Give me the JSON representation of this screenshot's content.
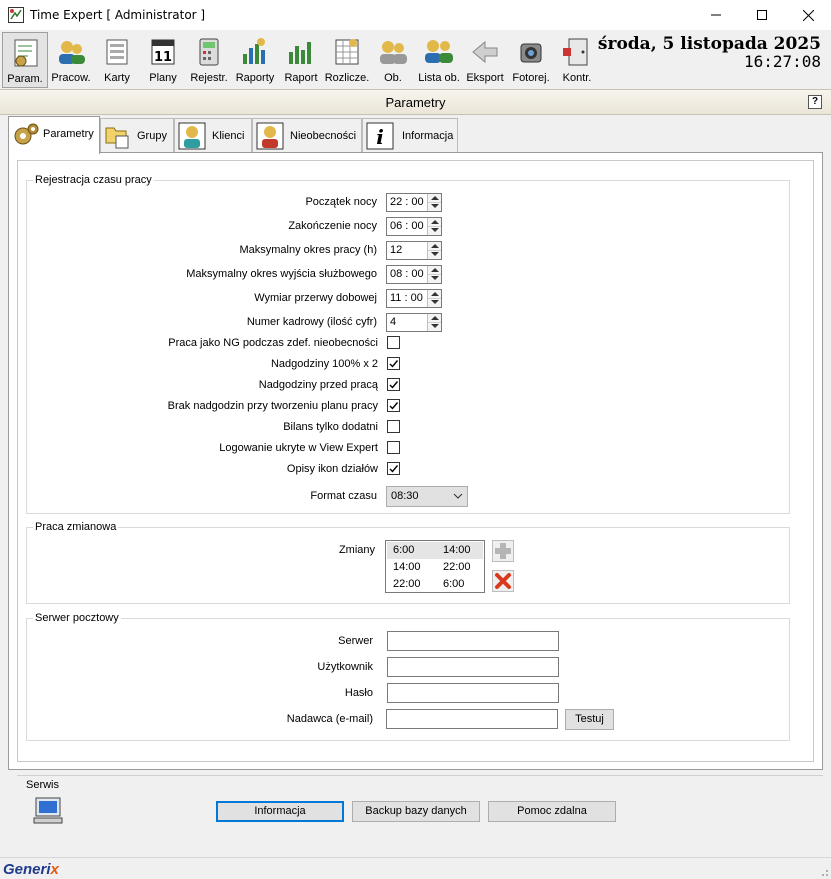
{
  "window": {
    "title": "Time Expert [ Administrator ]"
  },
  "toolbar": {
    "items": [
      {
        "label": "Param.",
        "icon": "parameters-icon"
      },
      {
        "label": "Pracow.",
        "icon": "employees-icon"
      },
      {
        "label": "Karty",
        "icon": "cards-icon"
      },
      {
        "label": "Plany",
        "icon": "calendar-icon"
      },
      {
        "label": "Rejestr.",
        "icon": "register-icon"
      },
      {
        "label": "Raporty",
        "icon": "reports-icon"
      },
      {
        "label": "Raport",
        "icon": "report-icon"
      },
      {
        "label": "Rozlicze.",
        "icon": "settlement-icon"
      },
      {
        "label": "Ob.",
        "icon": "presence-icon"
      },
      {
        "label": "Lista ob.",
        "icon": "presence-list-icon"
      },
      {
        "label": "Eksport",
        "icon": "export-arrow-icon"
      },
      {
        "label": "Fotorej.",
        "icon": "camera-icon"
      },
      {
        "label": "Kontr.",
        "icon": "door-controller-icon"
      }
    ],
    "date": "środa, 5 listopada 2025",
    "time": "16:27:08"
  },
  "header": {
    "title": "Parametry",
    "help": "?"
  },
  "tabs": [
    {
      "label": "Parametry",
      "icon": "gears-icon"
    },
    {
      "label": "Grupy",
      "icon": "folder-icon"
    },
    {
      "label": "Klienci",
      "icon": "client-icon"
    },
    {
      "label": "Nieobecności",
      "icon": "absence-icon"
    },
    {
      "label": "Informacja",
      "icon": "info-icon"
    }
  ],
  "registration": {
    "title": "Rejestracja czasu pracy",
    "fields": [
      {
        "label": "Początek nocy",
        "value": "22 : 00"
      },
      {
        "label": "Zakończenie nocy",
        "value": "06 : 00"
      },
      {
        "label": "Maksymalny okres pracy (h)",
        "value": "12"
      },
      {
        "label": "Maksymalny okres wyjścia służbowego",
        "value": "08 : 00"
      },
      {
        "label": "Wymiar przerwy dobowej",
        "value": "11 : 00"
      },
      {
        "label": "Numer kadrowy (ilość cyfr)",
        "value": "4"
      }
    ],
    "checkboxes": [
      {
        "label": "Praca jako NG podczas zdef. nieobecności",
        "checked": false
      },
      {
        "label": "Nadgodziny 100% x 2",
        "checked": true
      },
      {
        "label": "Nadgodziny przed pracą",
        "checked": true
      },
      {
        "label": "Brak nadgodzin przy tworzeniu planu pracy",
        "checked": true
      },
      {
        "label": "Bilans tylko dodatni",
        "checked": false
      },
      {
        "label": "Logowanie ukryte w View Expert",
        "checked": false
      },
      {
        "label": "Opisy ikon działów",
        "checked": true
      }
    ],
    "time_format": {
      "label": "Format czasu",
      "value": "08:30"
    }
  },
  "shifts": {
    "title": "Praca zmianowa",
    "label": "Zmiany",
    "rows": [
      {
        "start": "6:00",
        "end": "14:00"
      },
      {
        "start": "14:00",
        "end": "22:00"
      },
      {
        "start": "22:00",
        "end": "6:00"
      }
    ]
  },
  "mail": {
    "title": "Serwer pocztowy",
    "server_label": "Serwer",
    "user_label": "Użytkownik",
    "password_label": "Hasło",
    "sender_label": "Nadawca (e-mail)",
    "server": "",
    "user": "",
    "password": "",
    "sender": "",
    "test_button": "Testuj"
  },
  "service": {
    "title": "Serwis",
    "buttons": [
      "Informacja",
      "Backup bazy danych",
      "Pomoc zdalna"
    ]
  },
  "footer": {
    "brand_main": "Generi",
    "brand_x": "x"
  },
  "colors": {
    "accent": "#0078d7",
    "brand": "#1f3b8c",
    "brand_x": "#e8590c",
    "check": "#000000"
  }
}
